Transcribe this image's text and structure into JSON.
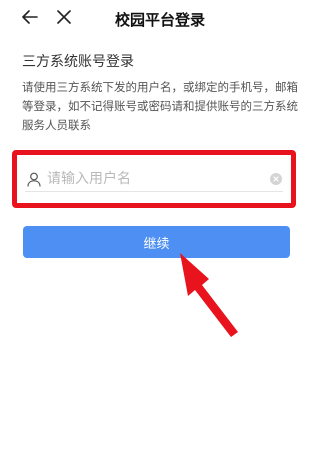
{
  "header": {
    "title": "校园平台登录",
    "back_icon": "arrow-left-icon",
    "close_icon": "close-icon"
  },
  "main": {
    "section_title": "三方系统账号登录",
    "description": "请使用三方系统下发的用户名，或绑定的手机号，邮箱等登录，如不记得账号或密码请和提供账号的三方系统服务人员联系",
    "username": {
      "placeholder": "请输入用户名",
      "value": "",
      "icon": "user-icon",
      "clear_icon": "clear-icon"
    },
    "continue_label": "继续"
  },
  "colors": {
    "accent": "#4d8ff2",
    "highlight": "#e8131c"
  }
}
